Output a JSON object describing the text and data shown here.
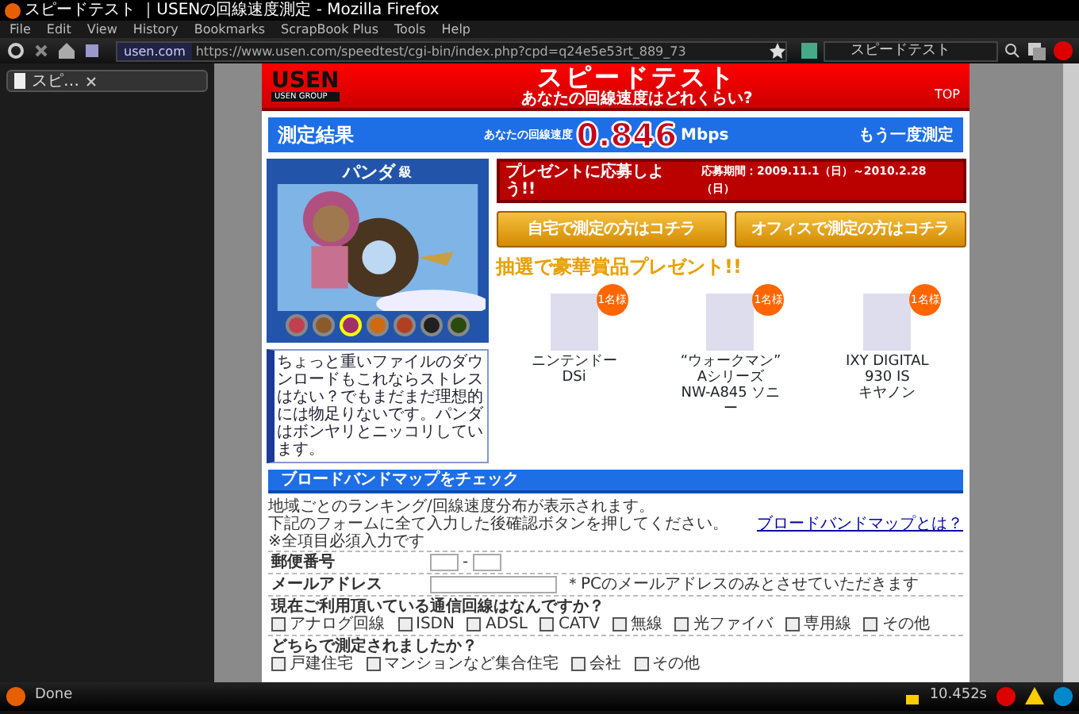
{
  "window": {
    "title": "スピードテスト ｜USENの回線速度測定 - Mozilla Firefox"
  },
  "menu": [
    "File",
    "Edit",
    "View",
    "History",
    "Bookmarks",
    "ScrapBook Plus",
    "Tools",
    "Help"
  ],
  "toolbar": {
    "site": "usen.com",
    "url": "https://www.usen.com/speedtest/cgi-bin/index.php?cpd=q24e5e53rt_889_73",
    "search": "スピードテスト"
  },
  "tabs": [
    {
      "label": "スピ…",
      "selected": true
    }
  ],
  "page": {
    "header": {
      "logo": "USEN",
      "logo_sub": "USEN GROUP",
      "title": "スピードテスト",
      "subtitle": "あなたの回線速度はどれくらい?",
      "top_link": "TOP"
    },
    "result": {
      "heading": "測定結果",
      "label": "あなたの回線速度",
      "speed": "0.846",
      "unit": "Mbps",
      "retry": "もう一度測定"
    },
    "rank": {
      "name": "パンダ",
      "suffix": "級",
      "characters": [
        {
          "color": "#c04050",
          "selected": false
        },
        {
          "color": "#8a5a2a",
          "selected": false
        },
        {
          "color": "#a0306a",
          "selected": true
        },
        {
          "color": "#d06a10",
          "selected": false
        },
        {
          "color": "#b04020",
          "selected": false
        },
        {
          "color": "#202020",
          "selected": false
        },
        {
          "color": "#2a4a10",
          "selected": false
        }
      ],
      "comment": "ちょっと重いファイルのダウンロードもこれならストレスはない？でもまだまだ理想的には物足りないです。パンダはボンヤリとニッコリしています。"
    },
    "present": {
      "banner": "プレゼントに応募しよう!!",
      "period": "応募期間：2009.11.1（日）～2010.2.28（日）",
      "buttons": [
        "自宅で測定の方はコチラ",
        "オフィスで測定の方はコチラ"
      ],
      "headline": "抽選で豪華賞品プレゼント!!",
      "prizes": [
        {
          "name": "ニンテンドーDSi",
          "badge": "1名様"
        },
        {
          "name": "“ウォークマン” Aシリーズ",
          "maker": "NW-A845 ソニー",
          "badge": "1名様"
        },
        {
          "name": "IXY DIGITAL 930 IS",
          "maker": "キヤノン",
          "badge": "1名様"
        }
      ]
    },
    "broadband": {
      "heading": "ブロードバンドマップをチェック",
      "lines": [
        "地域ごとのランキング/回線速度分布が表示されます。",
        "下記のフォームに全て入力した後確認ボタンを押してください。"
      ],
      "link": "ブロードバンドマップとは？",
      "note": "※全項目必須入力です",
      "fields": [
        {
          "kind": "zip",
          "label": "郵便番号",
          "separator": "-"
        },
        {
          "kind": "email",
          "label": "メールアドレス",
          "hint": "＊PCのメールアドレスのみとさせていただきます"
        },
        {
          "kind": "choices",
          "label": "現在ご利用頂いている通信回線はなんですか？",
          "options": [
            {
              "label": "アナログ回線",
              "checked": false
            },
            {
              "label": "ISDN",
              "checked": false
            },
            {
              "label": "ADSL",
              "checked": false
            },
            {
              "label": "CATV",
              "checked": false
            },
            {
              "label": "無線",
              "checked": false
            },
            {
              "label": "光ファイバ",
              "checked": false
            },
            {
              "label": "専用線",
              "checked": false
            },
            {
              "label": "その他",
              "checked": false
            }
          ]
        },
        {
          "kind": "choices",
          "label": "どちらで測定されましたか？",
          "options": [
            {
              "label": "戸建住宅",
              "checked": false
            },
            {
              "label": "マンションなど集合住宅",
              "checked": false
            },
            {
              "label": "会社",
              "checked": false
            },
            {
              "label": "その他",
              "checked": false
            }
          ]
        }
      ]
    }
  },
  "status_bar": {
    "text": "Done",
    "time": "10.452s"
  }
}
